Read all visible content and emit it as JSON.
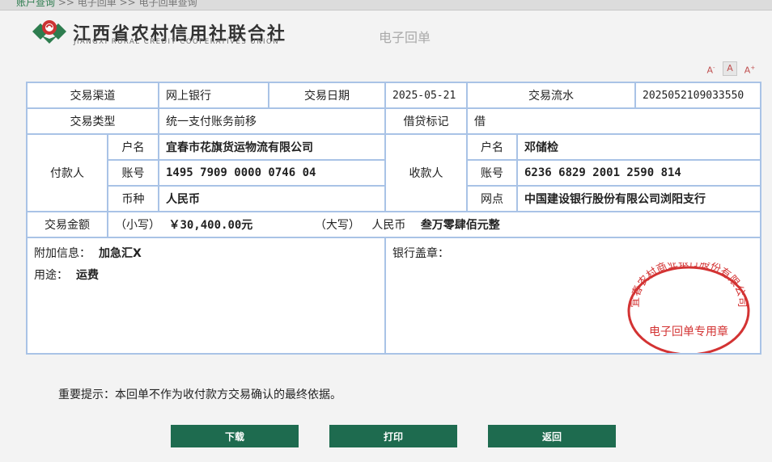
{
  "breadcrumb": {
    "home": "账户查询",
    "sep": ">>",
    "p1": "电子回单",
    "p2": "电子回单查询"
  },
  "brand": {
    "name_cn": "江西省农村信用社联合社",
    "name_en": "JIANGXI RURAL CREDIT COOPERATIVES UNION",
    "receipt_title": "电子回单",
    "logo_color": "#2e7d4f"
  },
  "font_size_controls": {
    "decrease": "A",
    "normal": "A",
    "increase": "A",
    "minus": "-",
    "plus": "+"
  },
  "receipt": {
    "channel_label": "交易渠道",
    "channel": "网上银行",
    "date_label": "交易日期",
    "date": "2025-05-21",
    "serial_label": "交易流水",
    "serial": "2025052109033550",
    "type_label": "交易类型",
    "type": "统一支付账务前移",
    "dc_label": "借贷标记",
    "dc": "借",
    "payer_label": "付款人",
    "payee_label": "收款人",
    "name_label": "户名",
    "account_label": "账号",
    "currency_label": "币种",
    "branch_label": "网点",
    "payer_name": "宜春市花旗货运物流有限公司",
    "payer_account": "1495 7909 0000 0746 04",
    "payer_currency": "人民币",
    "payee_name": "邓储检",
    "payee_account": "6236 6829 2001 2590 814",
    "payee_branch": "中国建设银行股份有限公司浏阳支行",
    "amount_label": "交易金额",
    "amount_small_label": "（小写）",
    "amount_small": "￥30,400.00元",
    "amount_big_label": "（大写）",
    "amount_big_currency": "人民币",
    "amount_big": "叁万零肆佰元整",
    "extra_label": "附加信息：",
    "extra": "加急汇X",
    "purpose_label": "用途：",
    "purpose": "运费",
    "seal_label": "银行盖章：",
    "stamp_top": "宜春农村商业银行股份有限公司",
    "stamp_bottom": "电子回单专用章",
    "stamp_color": "#d33333"
  },
  "notice": "重要提示：本回单不作为收付款方交易确认的最终依据。",
  "buttons": {
    "download": "下载",
    "print": "打印",
    "back": "返回"
  },
  "colors": {
    "button": "#1e6b4f",
    "border": "#a9c3e6"
  }
}
